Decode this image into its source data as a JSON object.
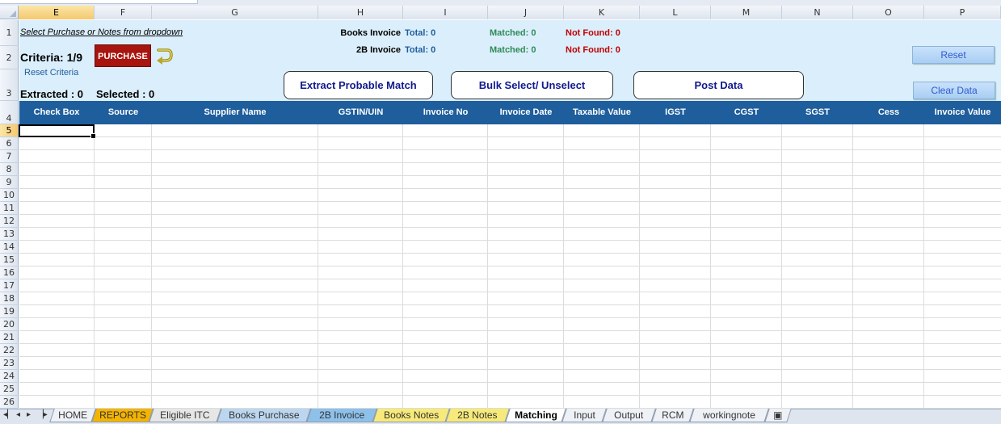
{
  "columns": [
    "E",
    "F",
    "G",
    "H",
    "I",
    "J",
    "K",
    "L",
    "M",
    "N",
    "O",
    "P"
  ],
  "selected_column": "E",
  "rows": [
    "1",
    "2",
    "3",
    "4",
    "5",
    "6",
    "7",
    "8",
    "9",
    "10",
    "11",
    "12",
    "13",
    "14",
    "15",
    "16",
    "17",
    "18",
    "19",
    "20",
    "21",
    "22",
    "23",
    "24",
    "25",
    "26"
  ],
  "selected_row": "5",
  "panel": {
    "instruction": "Select Purchase or Notes from dropdown",
    "criteria": "Criteria: 1/9",
    "purchase_button": "PURCHASE",
    "reset_criteria": "Reset Criteria",
    "extracted": "Extracted : 0",
    "selected": "Selected : 0",
    "books_invoice_label": "Books Invoice",
    "books_invoice_total": "Total: 0",
    "books_invoice_matched": "Matched: 0",
    "books_invoice_not_found": "Not Found: 0",
    "b2_invoice_label": "2B Invoice",
    "b2_invoice_total": "Total: 0",
    "b2_invoice_matched": "Matched: 0",
    "b2_invoice_not_found": "Not Found: 0",
    "extract_button": "Extract Probable Match",
    "bulk_button": "Bulk Select/ Unselect",
    "post_button": "Post  Data",
    "reset_button": "Reset",
    "clear_button": "Clear Data"
  },
  "table_headers": [
    "Check Box",
    "Source",
    "Supplier Name",
    "GSTIN/UIN",
    "Invoice No",
    "Invoice Date",
    "Taxable Value",
    "IGST",
    "CGST",
    "SGST",
    "Cess",
    "Invoice Value"
  ],
  "tabs": [
    "HOME",
    "REPORTS",
    "Eligible ITC",
    "Books Purchase",
    "2B Invoice",
    "Books Notes",
    "2B Notes",
    "Matching",
    "Input",
    "Output",
    "RCM",
    "workingnote"
  ],
  "active_tab": "Matching",
  "colors": {
    "header_band": "#1f5e9c",
    "panel_bg": "#dbeefb",
    "total": "#1f5e9c",
    "matched": "#2e8b57",
    "not_found": "#c00000",
    "purchase_btn": "#a8140e",
    "tab_reports": "#f4b400",
    "tab_eligible": "#d9d9d9",
    "tab_books_purchase": "#bcd6ef",
    "tab_2b_invoice": "#8ec1ea",
    "tab_books_notes": "#f7ea7a",
    "tab_2b_notes": "#f7ea7a"
  }
}
